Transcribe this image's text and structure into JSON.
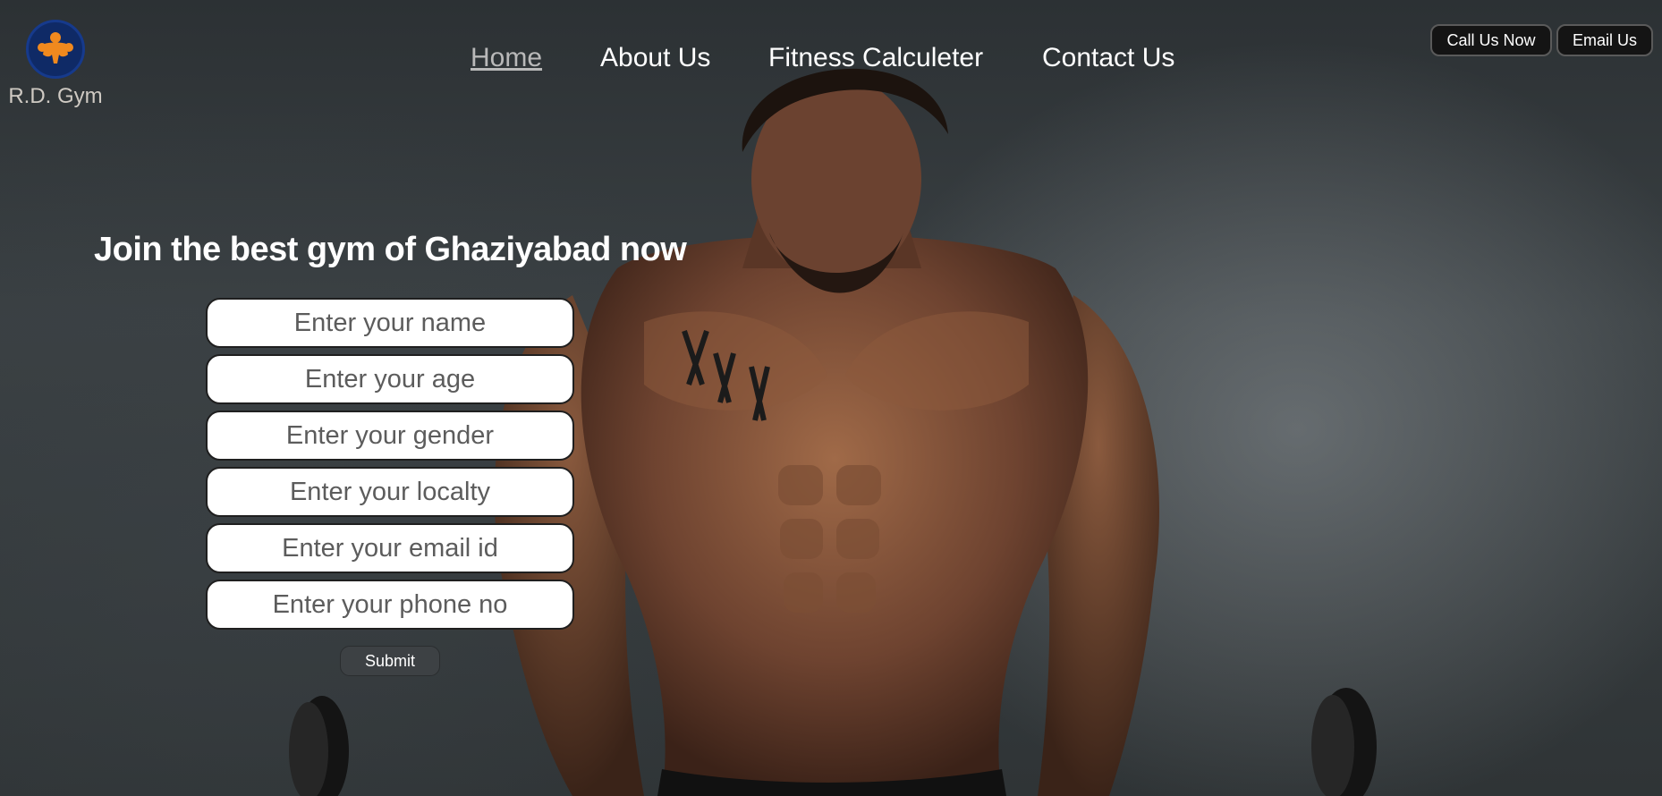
{
  "brand": {
    "name": "R.D. Gym",
    "logo_icon": "flexing-man-icon"
  },
  "nav": {
    "items": [
      "Home",
      "About Us",
      "Fitness Calculeter",
      "Contact Us"
    ],
    "active": "Home"
  },
  "header_actions": {
    "call_label": "Call Us Now",
    "email_label": "Email Us"
  },
  "join_form": {
    "headline": "Join the best gym of Ghaziyabad now",
    "fields": [
      {
        "placeholder": "Enter your name",
        "value": ""
      },
      {
        "placeholder": "Enter your age",
        "value": ""
      },
      {
        "placeholder": "Enter your gender",
        "value": ""
      },
      {
        "placeholder": "Enter your localty",
        "value": ""
      },
      {
        "placeholder": "Enter your email id",
        "value": ""
      },
      {
        "placeholder": "Enter your phone no",
        "value": ""
      }
    ],
    "submit_label": "Submit"
  },
  "colors": {
    "logo_orange": "#f0891e",
    "logo_blue": "#0f2a66",
    "active_nav": "#b9b9b9"
  }
}
